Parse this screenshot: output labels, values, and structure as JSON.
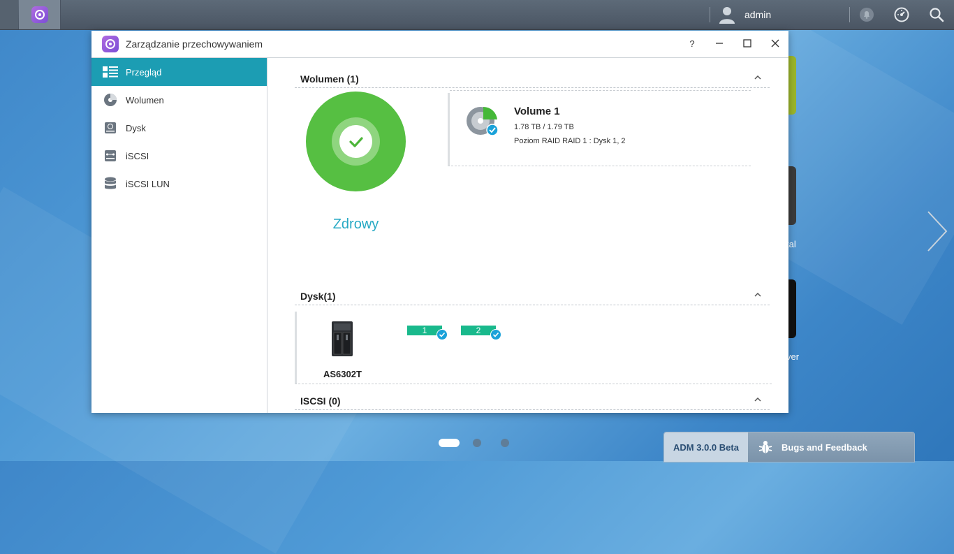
{
  "taskbar": {
    "username": "admin"
  },
  "window": {
    "title": "Zarządzanie przechowywaniem",
    "help_glyph": "?"
  },
  "sidebar": {
    "items": [
      {
        "label": "Przegląd",
        "icon": "overview-icon",
        "active": true
      },
      {
        "label": "Wolumen",
        "icon": "volume-icon",
        "active": false
      },
      {
        "label": "Dysk",
        "icon": "disk-icon",
        "active": false
      },
      {
        "label": "iSCSI",
        "icon": "iscsi-icon",
        "active": false
      },
      {
        "label": "iSCSI LUN",
        "icon": "iscsi-lun-icon",
        "active": false
      }
    ]
  },
  "overview": {
    "volume_section": {
      "title": "Wolumen (1)",
      "status": "Zdrowy",
      "volume": {
        "name": "Volume 1",
        "size": "1.78 TB / 1.79 TB",
        "raid": "Poziom RAID RAID 1 : Dysk 1, 2"
      }
    },
    "disk_section": {
      "title": "Dysk(1)",
      "nas_model": "AS6302T",
      "bays": [
        "1",
        "2"
      ]
    },
    "iscsi_section": {
      "title": "ISCSI (0)"
    }
  },
  "desktop": {
    "partial_labels": [
      "tal",
      "ver"
    ]
  },
  "footer": {
    "adm_version": "ADM 3.0.0 Beta",
    "bugs_label": "Bugs and Feedback"
  },
  "colors": {
    "accent": "#1c9db3",
    "healthy": "#56bf42",
    "bay_ok": "#19b98c",
    "check": "#1aa2d9"
  }
}
